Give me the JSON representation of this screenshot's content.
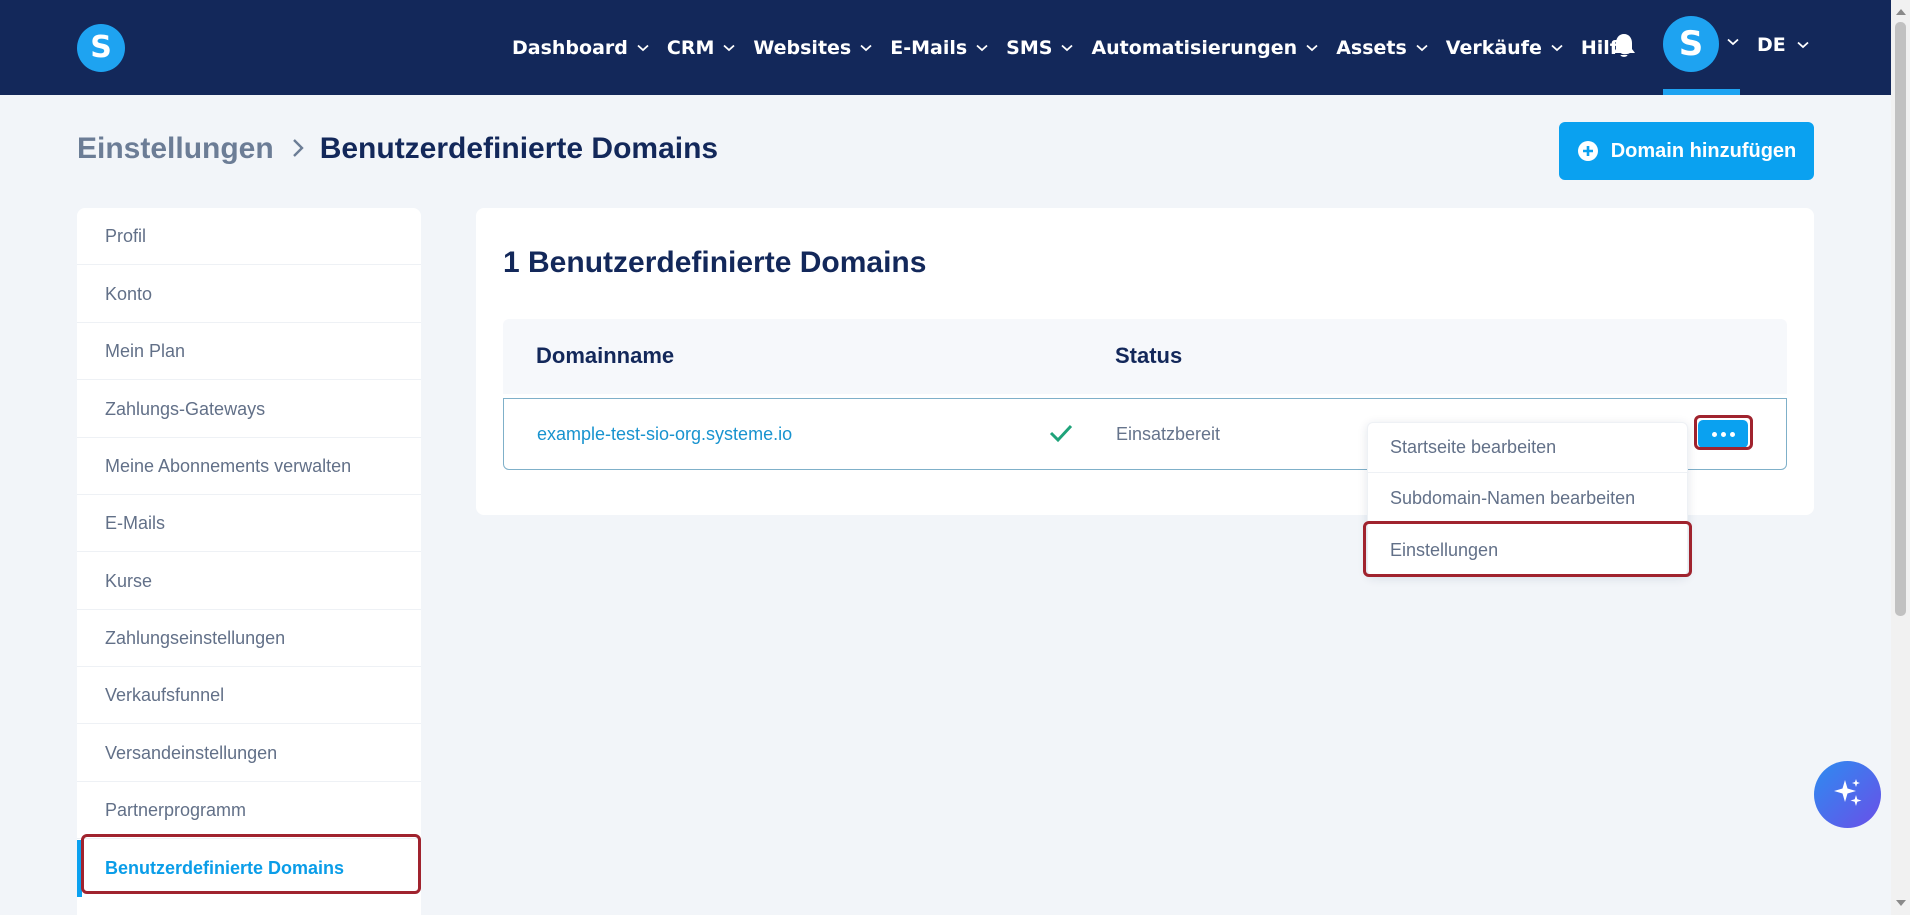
{
  "app": {
    "logo_letter": "S",
    "avatar_letter": "S",
    "language": "DE"
  },
  "nav": {
    "items": [
      {
        "label": "Dashboard",
        "has_dropdown": true
      },
      {
        "label": "CRM",
        "has_dropdown": true
      },
      {
        "label": "Websites",
        "has_dropdown": true
      },
      {
        "label": "E-Mails",
        "has_dropdown": true
      },
      {
        "label": "SMS",
        "has_dropdown": true
      },
      {
        "label": "Automatisierungen",
        "has_dropdown": true
      },
      {
        "label": "Assets",
        "has_dropdown": true
      },
      {
        "label": "Verkäufe",
        "has_dropdown": true
      },
      {
        "label": "Hilfe",
        "has_dropdown": false
      }
    ]
  },
  "breadcrumb": {
    "parent": "Einstellungen",
    "current": "Benutzerdefinierte Domains"
  },
  "header": {
    "add_button_label": "Domain hinzufügen"
  },
  "sidebar": {
    "items": [
      {
        "label": "Profil",
        "active": false
      },
      {
        "label": "Konto",
        "active": false
      },
      {
        "label": "Mein Plan",
        "active": false
      },
      {
        "label": "Zahlungs-Gateways",
        "active": false
      },
      {
        "label": "Meine Abonnements verwalten",
        "active": false
      },
      {
        "label": "E-Mails",
        "active": false
      },
      {
        "label": "Kurse",
        "active": false
      },
      {
        "label": "Zahlungseinstellungen",
        "active": false
      },
      {
        "label": "Verkaufsfunnel",
        "active": false
      },
      {
        "label": "Versandeinstellungen",
        "active": false
      },
      {
        "label": "Partnerprogramm",
        "active": false
      },
      {
        "label": "Benutzerdefinierte Domains",
        "active": true
      }
    ]
  },
  "main": {
    "title": "1 Benutzerdefinierte Domains",
    "columns": [
      "Domainname",
      "Status"
    ],
    "rows": [
      {
        "domain": "example-test-sio-org.systeme.io",
        "status": "Einsatzbereit"
      }
    ]
  },
  "dropdown": {
    "items": [
      "Startseite bearbeiten",
      "Subdomain-Namen bearbeiten",
      "Einstellungen"
    ]
  },
  "colors": {
    "nav_bg": "#13285a",
    "accent": "#0aa1f0",
    "highlight": "#a0232e",
    "success": "#1fa37a"
  }
}
